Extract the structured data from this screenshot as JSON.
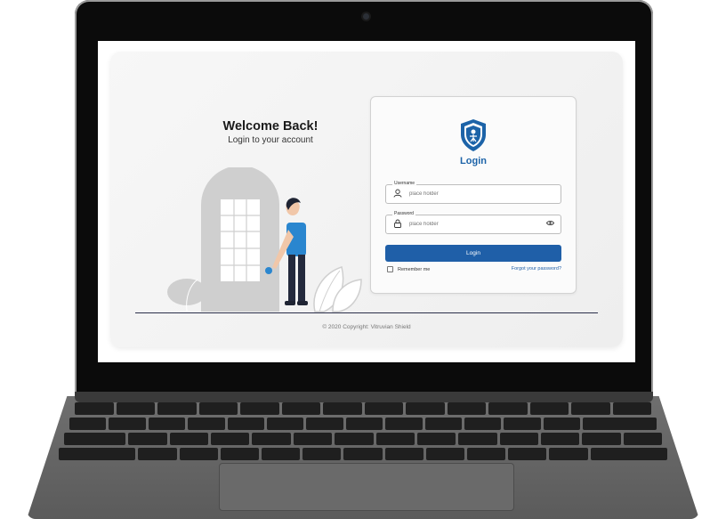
{
  "welcome": {
    "title": "Welcome Back!",
    "subtitle": "Login to your account"
  },
  "login": {
    "title": "Login",
    "username": {
      "label": "Username",
      "placeholder": "place holder",
      "icon": "user-icon"
    },
    "password": {
      "label": "Password",
      "placeholder": "place holder",
      "icon": "lock-icon",
      "toggle_icon": "eye-icon"
    },
    "button_label": "Login",
    "remember_label": "Remember me",
    "forgot_label": "Forgot your password?"
  },
  "footer": {
    "copyright": "© 2020 Copyright: Vitruvian Shield"
  },
  "colors": {
    "accent": "#1f5fa8",
    "title_blue": "#1c63a8",
    "figure_shirt": "#2a86cf",
    "figure_pants": "#242a3d",
    "door_gray": "#cfcfcf"
  }
}
